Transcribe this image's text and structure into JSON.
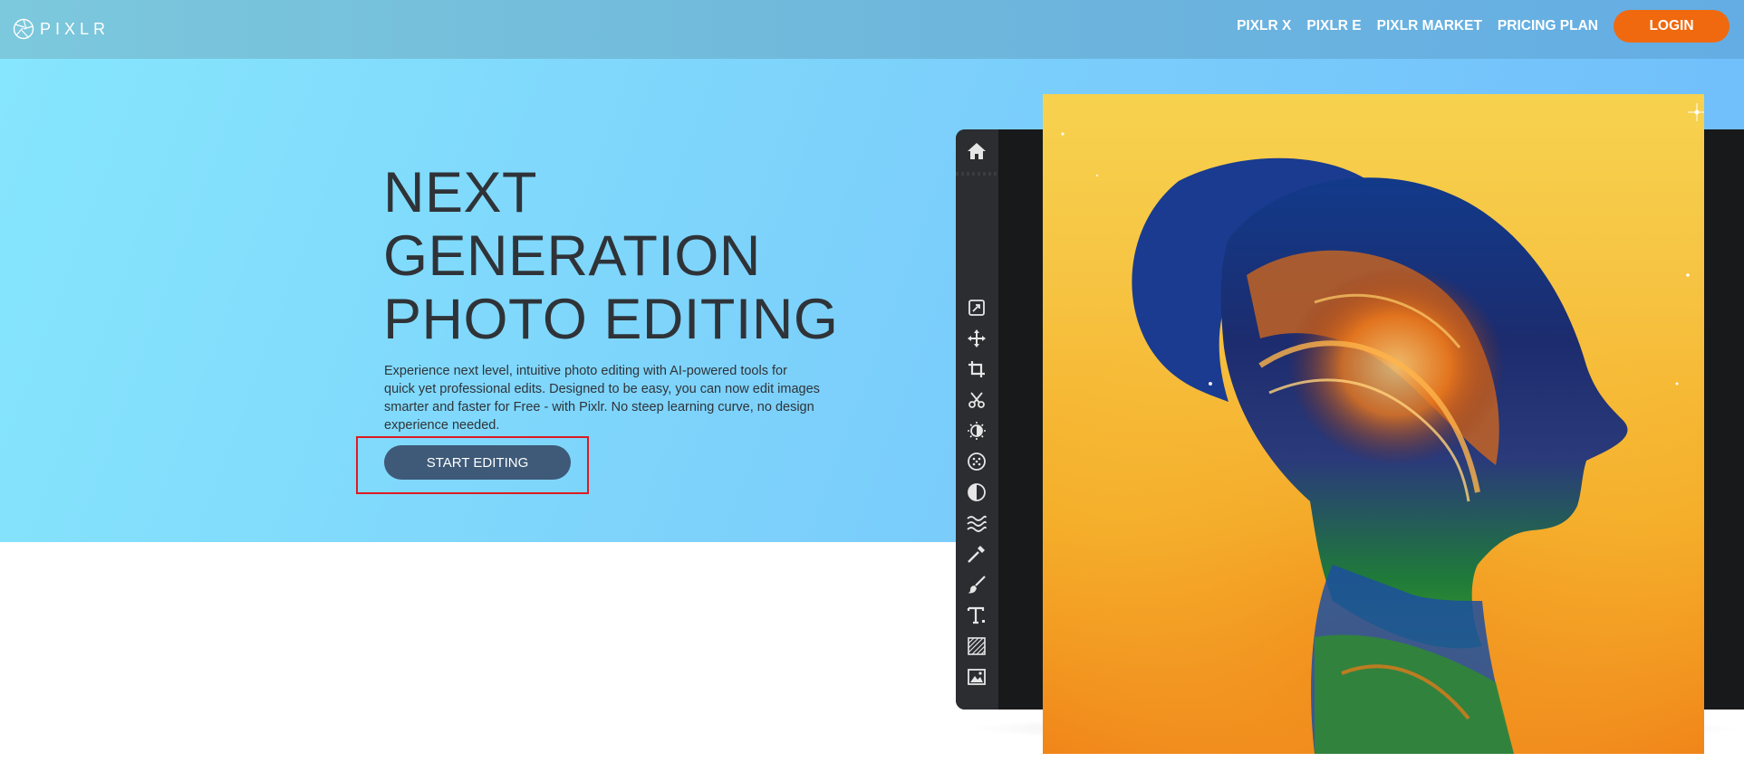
{
  "header": {
    "logo_text": "PIXLR",
    "nav": [
      "PIXLR X",
      "PIXLR E",
      "PIXLR MARKET",
      "PRICING PLAN"
    ],
    "login_label": "LOGIN"
  },
  "hero": {
    "headline": [
      "NEXT",
      "GENERATION",
      "PHOTO EDITING"
    ],
    "description": [
      "Experience next level, intuitive photo editing with AI-powered tools for",
      "quick yet professional edits. Designed to be easy, you can now edit images",
      "smarter and faster for Free - with Pixlr. No steep learning curve, no design",
      "experience needed."
    ],
    "cta_label": "START EDITING"
  },
  "editor": {
    "tools": [
      "home-icon",
      "arrange-icon",
      "move-icon",
      "crop-icon",
      "cutout-icon",
      "adjust-icon",
      "filter-icon",
      "effect-icon",
      "liquify-icon",
      "retouch-icon",
      "draw-icon",
      "text-icon",
      "pattern-icon",
      "image-icon"
    ]
  },
  "colors": {
    "accent": "#f0690f",
    "cta": "#3e5a78",
    "highlight": "#dd1a22",
    "text": "#2f3338"
  }
}
